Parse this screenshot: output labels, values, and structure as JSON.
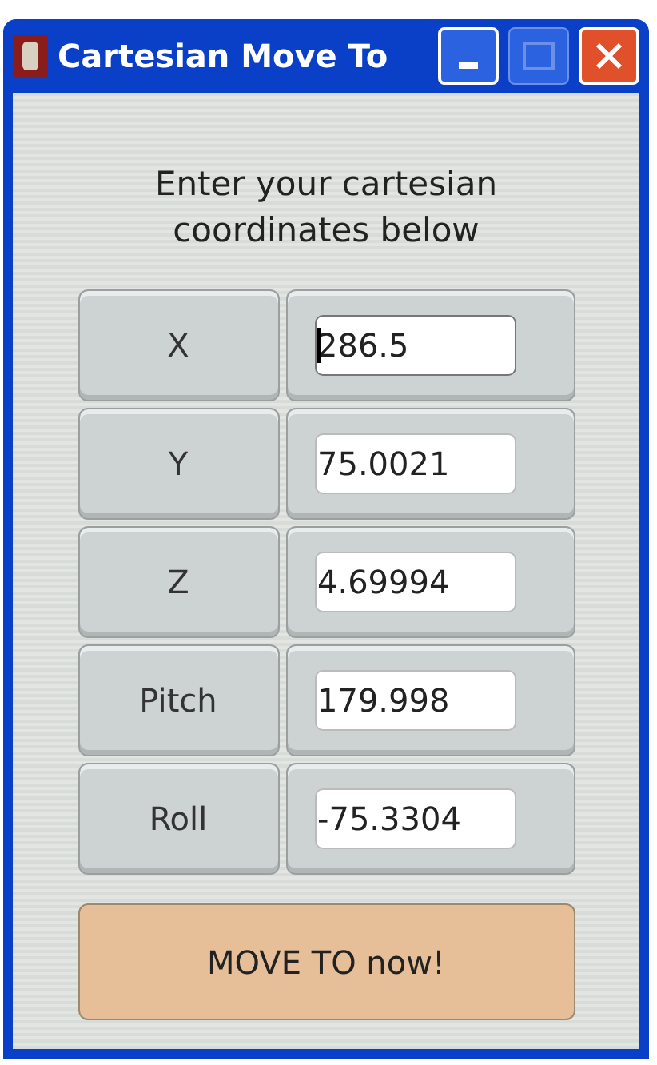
{
  "window": {
    "title": "Cartesian Move To"
  },
  "instruction": "Enter your cartesian coordinates below",
  "fields": [
    {
      "label": "X",
      "value": "286.5",
      "focused": true
    },
    {
      "label": "Y",
      "value": "75.0021",
      "focused": false
    },
    {
      "label": "Z",
      "value": "4.69994",
      "focused": false
    },
    {
      "label": "Pitch",
      "value": "179.998",
      "focused": false
    },
    {
      "label": "Roll",
      "value": "-75.3304",
      "focused": false
    }
  ],
  "button": "MOVE TO now!"
}
